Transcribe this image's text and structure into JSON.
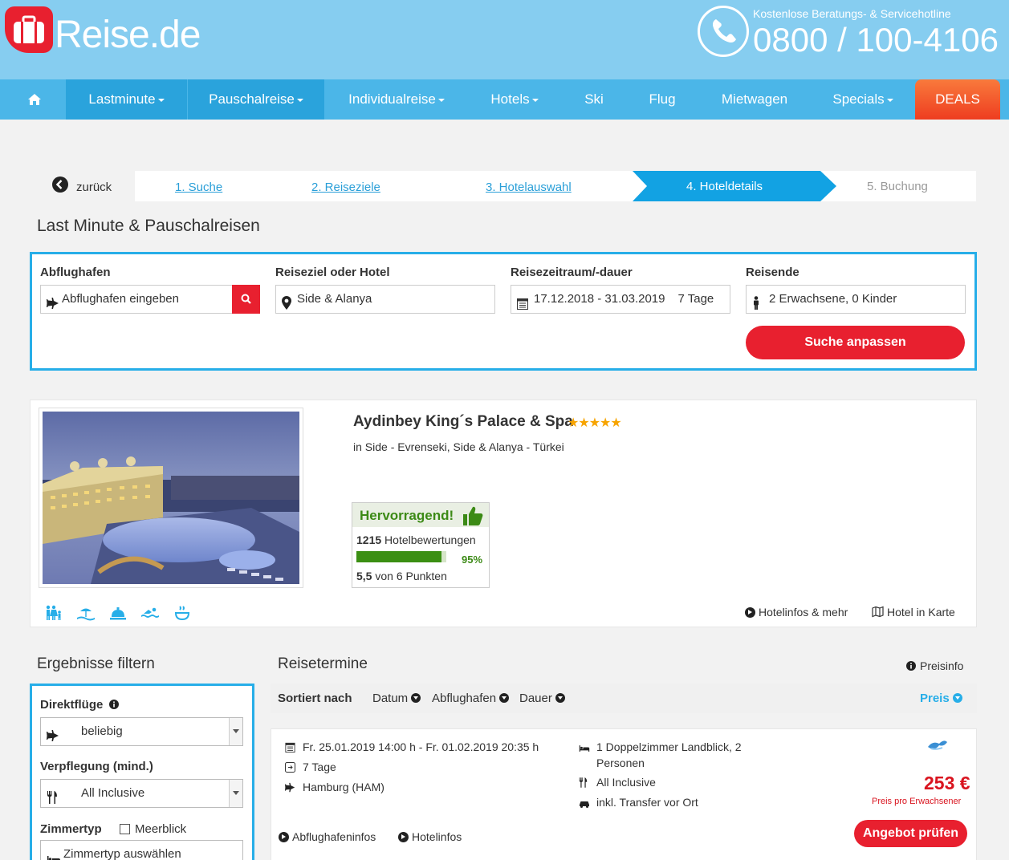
{
  "header": {
    "logo_main": "Reise",
    "logo_tld": ".de",
    "hotline_label": "Kostenlose Beratungs- & Servicehotline",
    "hotline_number": "0800 / 100-4106"
  },
  "nav": {
    "items": [
      {
        "label": "Lastminute",
        "dropdown": true
      },
      {
        "label": "Pauschalreise",
        "dropdown": true
      },
      {
        "label": "Individualreise",
        "dropdown": true
      },
      {
        "label": "Hotels",
        "dropdown": true
      },
      {
        "label": "Ski",
        "dropdown": false
      },
      {
        "label": "Flug",
        "dropdown": false
      },
      {
        "label": "Mietwagen",
        "dropdown": false
      },
      {
        "label": "Specials",
        "dropdown": true
      }
    ],
    "deals_label": "DEALS"
  },
  "steps": {
    "back_label": "zurück",
    "items": [
      "1. Suche",
      "2. Reiseziele",
      "3. Hotelauswahl",
      "4. Hoteldetails",
      "5. Buchung"
    ]
  },
  "page_title": "Last Minute & Pauschalreisen",
  "search": {
    "departure_label": "Abflughafen",
    "departure_placeholder": "Abflughafen eingeben",
    "destination_label": "Reiseziel oder Hotel",
    "destination_value": "Side & Alanya",
    "period_label": "Reisezeitraum/-dauer",
    "period_value": "17.12.2018 - 31.03.2019",
    "duration_value": "7 Tage",
    "travelers_label": "Reisende",
    "travelers_value": "2 Erwachsene, 0 Kinder",
    "submit_label": "Suche anpassen"
  },
  "hotel": {
    "name": "Aydinbey King´s Palace & Spa",
    "stars_text": "★★★★★",
    "star_count": 5,
    "location": "in Side - Evrenseki, Side & Alanya - Türkei",
    "rating": {
      "label": "Hervorragend!",
      "review_count": "1215",
      "review_count_label": "Hotelbewertungen",
      "percent_text": "95%",
      "percent": 95,
      "score": "5,5",
      "score_suffix": "von 6 Punkten"
    },
    "links": {
      "info": "Hotelinfos & mehr",
      "map": "Hotel in Karte"
    }
  },
  "filters": {
    "title": "Ergebnisse filtern",
    "direct_flights_label": "Direktflüge",
    "direct_flights_value": "beliebig",
    "board_label": "Verpflegung (mind.)",
    "board_value": "All Inclusive",
    "room_type_label": "Zimmertyp",
    "sea_view_label": "Meerblick",
    "room_type_placeholder": "Zimmertyp auswählen"
  },
  "results": {
    "title": "Reisetermine",
    "preisinfo_label": "Preisinfo",
    "sort_label": "Sortiert nach",
    "sort_options": [
      "Datum",
      "Abflughafen",
      "Dauer"
    ],
    "sort_active": "Preis",
    "offer": {
      "dates": "Fr. 25.01.2019 14:00 h - Fr. 01.02.2019 20:35 h",
      "duration": "7 Tage",
      "airport": "Hamburg (HAM)",
      "room_line1": "1 Doppelzimmer Landblick, 2",
      "room_line2": "Personen",
      "board": "All Inclusive",
      "transfer": "inkl. Transfer vor Ort",
      "price": "253 €",
      "price_note": "Preis pro Erwachsener",
      "button_label": "Angebot prüfen",
      "link_airport": "Abflughafeninfos",
      "link_hotel": "Hotelinfos"
    }
  },
  "colors": {
    "header_bg": "#86cdf0",
    "nav_bg": "#4bb6e8",
    "accent_blue": "#27aee8",
    "brand_red": "#e8202f",
    "rating_green": "#3b8f13"
  }
}
